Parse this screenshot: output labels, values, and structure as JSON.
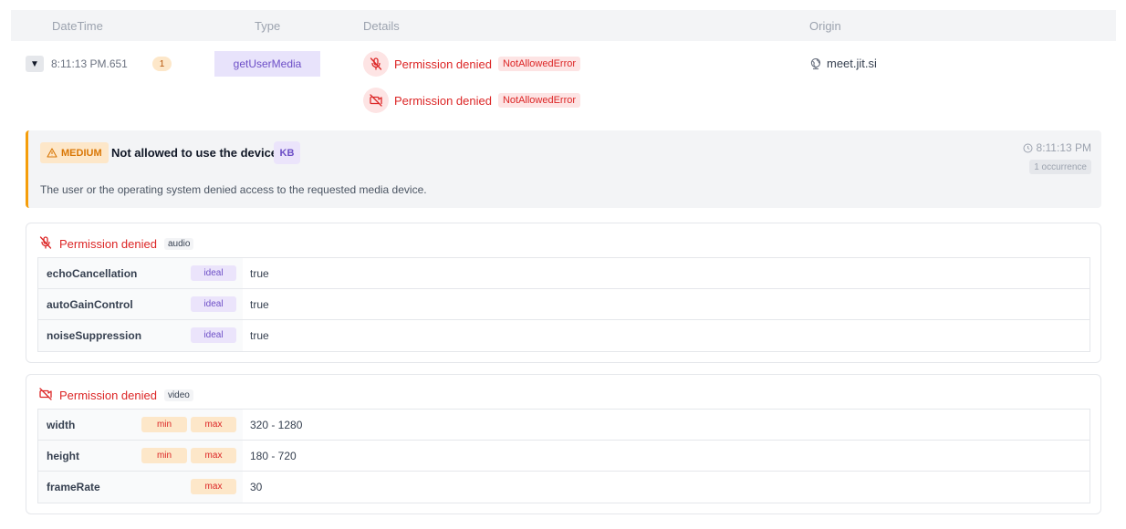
{
  "table_header": {
    "datetime": "DateTime",
    "type": "Type",
    "details": "Details",
    "origin": "Origin"
  },
  "event": {
    "time": "8:11:13 PM.651",
    "count": "1",
    "type": "getUserMedia",
    "details": [
      {
        "icon": "mic-off-icon",
        "text": "Permission denied",
        "error": "NotAllowedError"
      },
      {
        "icon": "camera-off-icon",
        "text": "Permission denied",
        "error": "NotAllowedError"
      }
    ],
    "origin": "meet.jit.si"
  },
  "alert": {
    "severity": "MEDIUM",
    "title": "Not allowed to use the device",
    "kb_label": "KB",
    "time": "8:11:13 PM",
    "occurrences": "1 occurrence",
    "description": "The user or the operating system denied access to the requested media device."
  },
  "audio_card": {
    "label": "Permission denied",
    "kind": "audio",
    "rows": [
      {
        "name": "echoCancellation",
        "tags": [
          "ideal"
        ],
        "value": "true"
      },
      {
        "name": "autoGainControl",
        "tags": [
          "ideal"
        ],
        "value": "true"
      },
      {
        "name": "noiseSuppression",
        "tags": [
          "ideal"
        ],
        "value": "true"
      }
    ]
  },
  "video_card": {
    "label": "Permission denied",
    "kind": "video",
    "rows": [
      {
        "name": "width",
        "tags": [
          "min",
          "max"
        ],
        "value": "320 - 1280"
      },
      {
        "name": "height",
        "tags": [
          "min",
          "max"
        ],
        "value": "180 - 720"
      },
      {
        "name": "frameRate",
        "tags": [
          "max"
        ],
        "value": "30"
      }
    ]
  },
  "colors": {
    "error_red": "#dc2626",
    "purple": "#6d4fc7",
    "warning_orange": "#f59e0b"
  }
}
